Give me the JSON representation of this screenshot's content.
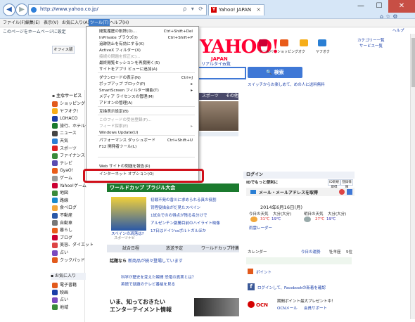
{
  "browser": {
    "address": "http://www.yahoo.co.jp/",
    "address_tools": "ρ ▾ ⟳",
    "tab_title": "Yahoo! JAPAN",
    "tab_close": "×",
    "back_icon": "back-arrow-icon",
    "forward_icon": "forward-arrow-icon"
  },
  "window": {
    "minimize": "—",
    "maximize": "☐",
    "close": "✕"
  },
  "menu": {
    "file": "ファイル(F)",
    "edit": "編集(E)",
    "view": "表示(V)",
    "favorites": "お気に入り(A)",
    "tools": "ツール(T)",
    "help": "ヘルプ(H)"
  },
  "favbar": {
    "text": "このページをホームページに設定"
  },
  "tools_menu": [
    {
      "label": "閲覧履歴の削除(D)...",
      "shortcut": "Ctrl+Shift+Del",
      "disabled": false
    },
    {
      "label": "InPrivate ブラウズ(I)",
      "shortcut": "Ctrl+Shift+P",
      "disabled": false
    },
    {
      "label": "追跡防止を有効にする(K)",
      "shortcut": "",
      "disabled": false
    },
    {
      "label": "ActiveX フィルター(X)",
      "shortcut": "",
      "disabled": false
    },
    {
      "label": "接続の問題を修正(C)...",
      "shortcut": "",
      "disabled": true
    },
    {
      "label": "最終閲覧セッションを再度開く(S)",
      "shortcut": "",
      "disabled": false
    },
    {
      "label": "サイトをアプリ ビューに追加(A)",
      "shortcut": "",
      "disabled": false
    },
    {
      "label": "ダウンロードの表示(N)",
      "shortcut": "Ctrl+J",
      "disabled": false
    },
    {
      "label": "ポップアップ ブロック(P)",
      "shortcut": "▸",
      "disabled": false
    },
    {
      "label": "SmartScreen フィルター機能(T)",
      "shortcut": "▸",
      "disabled": false
    },
    {
      "label": "メディア ライセンスの管理(M)",
      "shortcut": "",
      "disabled": false
    },
    {
      "label": "アドオンの管理(A)",
      "shortcut": "",
      "disabled": false
    },
    {
      "label": "互換表示設定(B)",
      "shortcut": "",
      "disabled": false
    },
    {
      "label": "このフィードの受信登録(F)...",
      "shortcut": "",
      "disabled": true
    },
    {
      "label": "フィード探索(E)",
      "shortcut": "▸",
      "disabled": true
    },
    {
      "label": "Windows Update(U)",
      "shortcut": "",
      "disabled": false
    },
    {
      "label": "パフォーマンス ダッシュボード",
      "shortcut": "Ctrl+Shift+U",
      "disabled": false
    },
    {
      "label": "F12 開発者ツール(L)",
      "shortcut": "",
      "disabled": false
    },
    {
      "label": "Web サイトの問題を報告(R)",
      "shortcut": "",
      "disabled": false
    },
    {
      "label": "インターネット オプション(O)",
      "shortcut": "",
      "disabled": false
    }
  ],
  "page": {
    "logo": "YAHOO!",
    "logo_sub": "JAPAN",
    "office_btn": "オフィス版",
    "help": "ヘルプ",
    "register": "カテゴリー一覧",
    "all_services": "サービス一覧",
    "top_icons": [
      "ツールバー",
      "ショッピング",
      "オク",
      "ヤフオク"
    ],
    "realtime_tab": "リアルタイム",
    "list_tab": "一覧",
    "search_btn": "検索",
    "search_hint": "スイッチからお楽しめて、めの人に送料無料",
    "side_header": "主なサービス",
    "side_items": [
      "ショッピング",
      "ヤフオク!",
      "LOHACO",
      "旅行、ホテル予約",
      "ニュース",
      "天気",
      "スポーツ",
      "ファイナンス",
      "テレビ",
      "GyaO!",
      "ゲーム",
      "Yahoo!ゲーム",
      "地図",
      "路線",
      "食べログ",
      "不動産",
      "自動車",
      "暮らし",
      "ブログ",
      "美容、ダイエット",
      "占い",
      "クックパッド"
    ],
    "side_bottom_header": "お気に入り",
    "side_bottom_items": [
      "電子書籍",
      "映画",
      "占い",
      "地域"
    ],
    "news_tabs": [
      "スポーツ",
      "その他"
    ],
    "worldcup_title": "ワールドカップ ブラジル大会",
    "worldcup_items": [
      "初戦不発の香川に求められる真の役割",
      "背程役描会がだ見たスペイン",
      "1試合でのの得点が残る名分けで",
      "アルゼンチン劇勝目前のハイライト映像",
      "17日はドイツvsポルトガルほか"
    ],
    "worldcup_caption": "スペインの凋落は?",
    "worldcup_sub": "スポーツナビ",
    "tabs_bottom": [
      "試合日程",
      "放送予定",
      "ワールドカップ特集"
    ],
    "ad_text": "新商品が続々登場しています",
    "bottom_news": [
      "科学が歴史を変えた瞬間 恐竜の真実とは？",
      "英語で話題のテレビ番組を見る"
    ],
    "promo_title": "いま、知っておきたい",
    "promo_sub": "エンターテイメント情報",
    "login_title": "ログイン",
    "login_sub": "IDでもっと便利に",
    "login_links": [
      "ID新規取得",
      "登録情報"
    ],
    "mail_label": "メール・メールアドレスを取得",
    "date": "2014年6月16日(月)",
    "weather_today": "今日の天気",
    "weather_tomorrow": "明日の天気",
    "place": "大分(大分)",
    "temp_today_hi": "31℃",
    "temp_today_lo": "19℃",
    "temp_tm_hi": "27℃",
    "temp_tm_lo": "19℃",
    "rain_radar": "雨雲レーダー",
    "calendar": "カレンダー",
    "calendar_link": "今日の運勢",
    "horoscope": "牡羊座",
    "horoscope_num": "5位",
    "point_label": "ポイント",
    "facebook_label": "ログインして、Facebookの新着を確認",
    "ocn_label": "OCN",
    "ocn_sub": "期間ポイント最大プレゼント中！",
    "ocn_links": [
      "OCNメール",
      "会員サポート"
    ]
  }
}
